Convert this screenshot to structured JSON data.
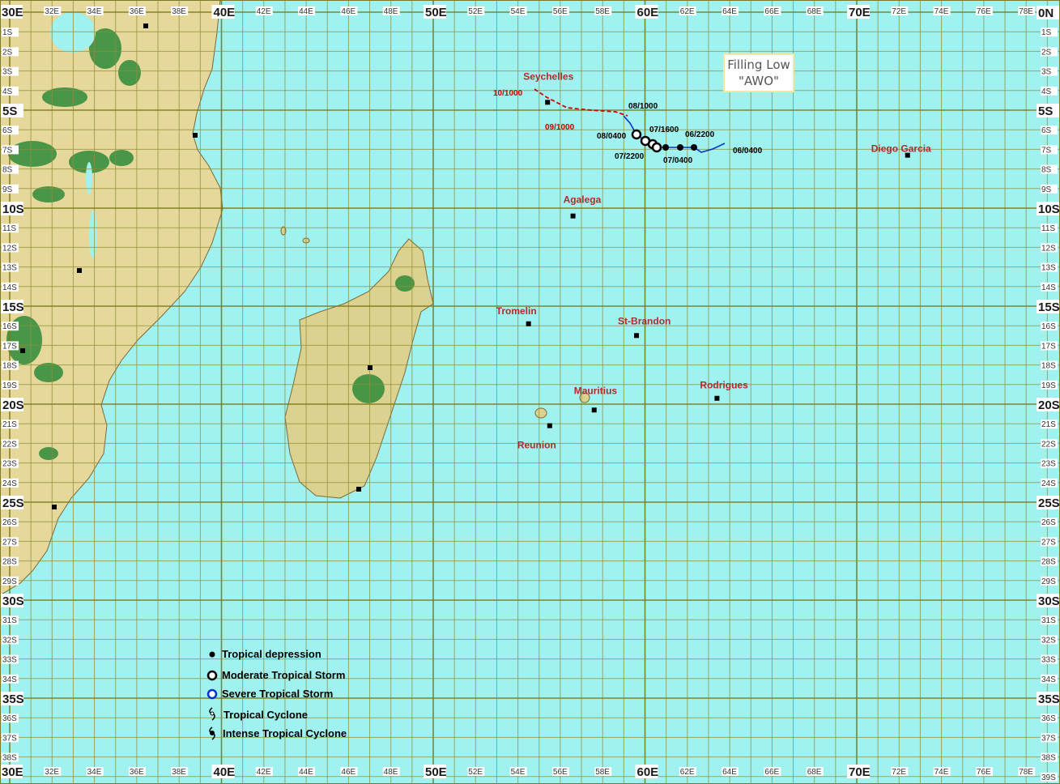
{
  "map": {
    "lon_labels_major": [
      "30E",
      "40E",
      "50E",
      "60E",
      "70E"
    ],
    "lon_labels_minor": [
      "32E",
      "34E",
      "36E",
      "38E",
      "42E",
      "44E",
      "46E",
      "48E",
      "52E",
      "54E",
      "56E",
      "58E",
      "62E",
      "64E",
      "66E",
      "68E",
      "72E",
      "74E",
      "76E",
      "78E"
    ],
    "lat_labels_major": [
      "0N",
      "5S",
      "10S",
      "15S",
      "20S",
      "25S",
      "30S",
      "35S"
    ],
    "lat_labels_minor": [
      "1S",
      "2S",
      "3S",
      "4S",
      "6S",
      "7S",
      "8S",
      "9S",
      "11S",
      "12S",
      "13S",
      "14S",
      "16S",
      "17S",
      "18S",
      "19S",
      "21S",
      "22S",
      "23S",
      "24S",
      "26S",
      "27S",
      "28S",
      "29S",
      "31S",
      "32S",
      "33S",
      "34S",
      "36S",
      "37S",
      "38S",
      "39S"
    ],
    "bottom_right_label": "39S",
    "bottom_left_label": "30E",
    "top_left_label": "30E",
    "colors": {
      "ocean": "#9ff2f0",
      "grid": "#8a8a2a",
      "land": "#e8d8a0",
      "forest": "#2e8b3a",
      "track_red": "#cc0000",
      "track_blue": "#0033cc"
    }
  },
  "places": [
    {
      "name": "Seychelles",
      "lon": 55.4,
      "lat": -4.6
    },
    {
      "name": "Agalega",
      "lon": 56.6,
      "lat": -10.4
    },
    {
      "name": "Tromelin",
      "lon": 54.5,
      "lat": -15.9
    },
    {
      "name": "St-Brandon",
      "lon": 59.6,
      "lat": -16.5
    },
    {
      "name": "Mauritius",
      "lon": 57.6,
      "lat": -20.3
    },
    {
      "name": "Reunion",
      "lon": 55.5,
      "lat": -21.1
    },
    {
      "name": "Rodrigues",
      "lon": 63.4,
      "lat": -19.7
    },
    {
      "name": "Diego Garcia",
      "lon": 72.4,
      "lat": -7.3
    }
  ],
  "system": {
    "title_line1": "Filling Low",
    "title_line2": "\"AWO\""
  },
  "track": {
    "labels": [
      {
        "text": "06/0400",
        "color": "black"
      },
      {
        "text": "06/2200",
        "color": "black"
      },
      {
        "text": "07/0400",
        "color": "black"
      },
      {
        "text": "07/1600",
        "color": "black"
      },
      {
        "text": "07/2200",
        "color": "black"
      },
      {
        "text": "08/0400",
        "color": "black"
      },
      {
        "text": "08/1000",
        "color": "black"
      },
      {
        "text": "09/1000",
        "color": "red"
      },
      {
        "text": "10/1000",
        "color": "red"
      }
    ]
  },
  "legend": {
    "items": [
      {
        "label": "Tropical depression",
        "symbol": "dot"
      },
      {
        "label": "Moderate Tropical Storm",
        "symbol": "ring-black"
      },
      {
        "label": "Severe Tropical Storm",
        "symbol": "ring-blue"
      },
      {
        "label": "Tropical Cyclone",
        "symbol": "cyclone"
      },
      {
        "label": "Intense Tropical Cyclone",
        "symbol": "intense-cyclone"
      }
    ]
  }
}
